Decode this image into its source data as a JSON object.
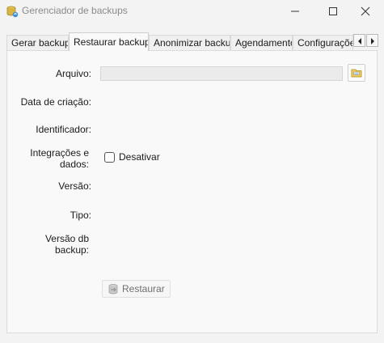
{
  "window": {
    "title": "Gerenciador de backups",
    "icons": {
      "app": "database-backup-icon",
      "minimize": "minimize-icon",
      "maximize": "maximize-icon",
      "close": "close-icon"
    }
  },
  "tabs": [
    {
      "label": "Gerar backup",
      "active": false
    },
    {
      "label": "Restaurar backup",
      "active": true
    },
    {
      "label": "Anonimizar backup",
      "active": false
    },
    {
      "label": "Agendamento",
      "active": false
    },
    {
      "label": "Configurações",
      "active": false
    }
  ],
  "form": {
    "arquivo_label": "Arquivo:",
    "arquivo_value": "",
    "data_criacao_label": "Data de criação:",
    "identificador_label": "Identificador:",
    "integracoes_label_line1": "Integrações e",
    "integracoes_label_line2": "dados:",
    "desativar_label": "Desativar",
    "desativar_checked": false,
    "versao_label": "Versão:",
    "tipo_label": "Tipo:",
    "versao_db_label_line1": "Versão db",
    "versao_db_label_line2": "backup:",
    "restore_button_label": "Restaurar",
    "restore_enabled": false
  },
  "colors": {
    "window_bg": "#f3f3f3",
    "panel_bg": "#f9f9f9",
    "disabled_text": "#6f6f6f"
  }
}
